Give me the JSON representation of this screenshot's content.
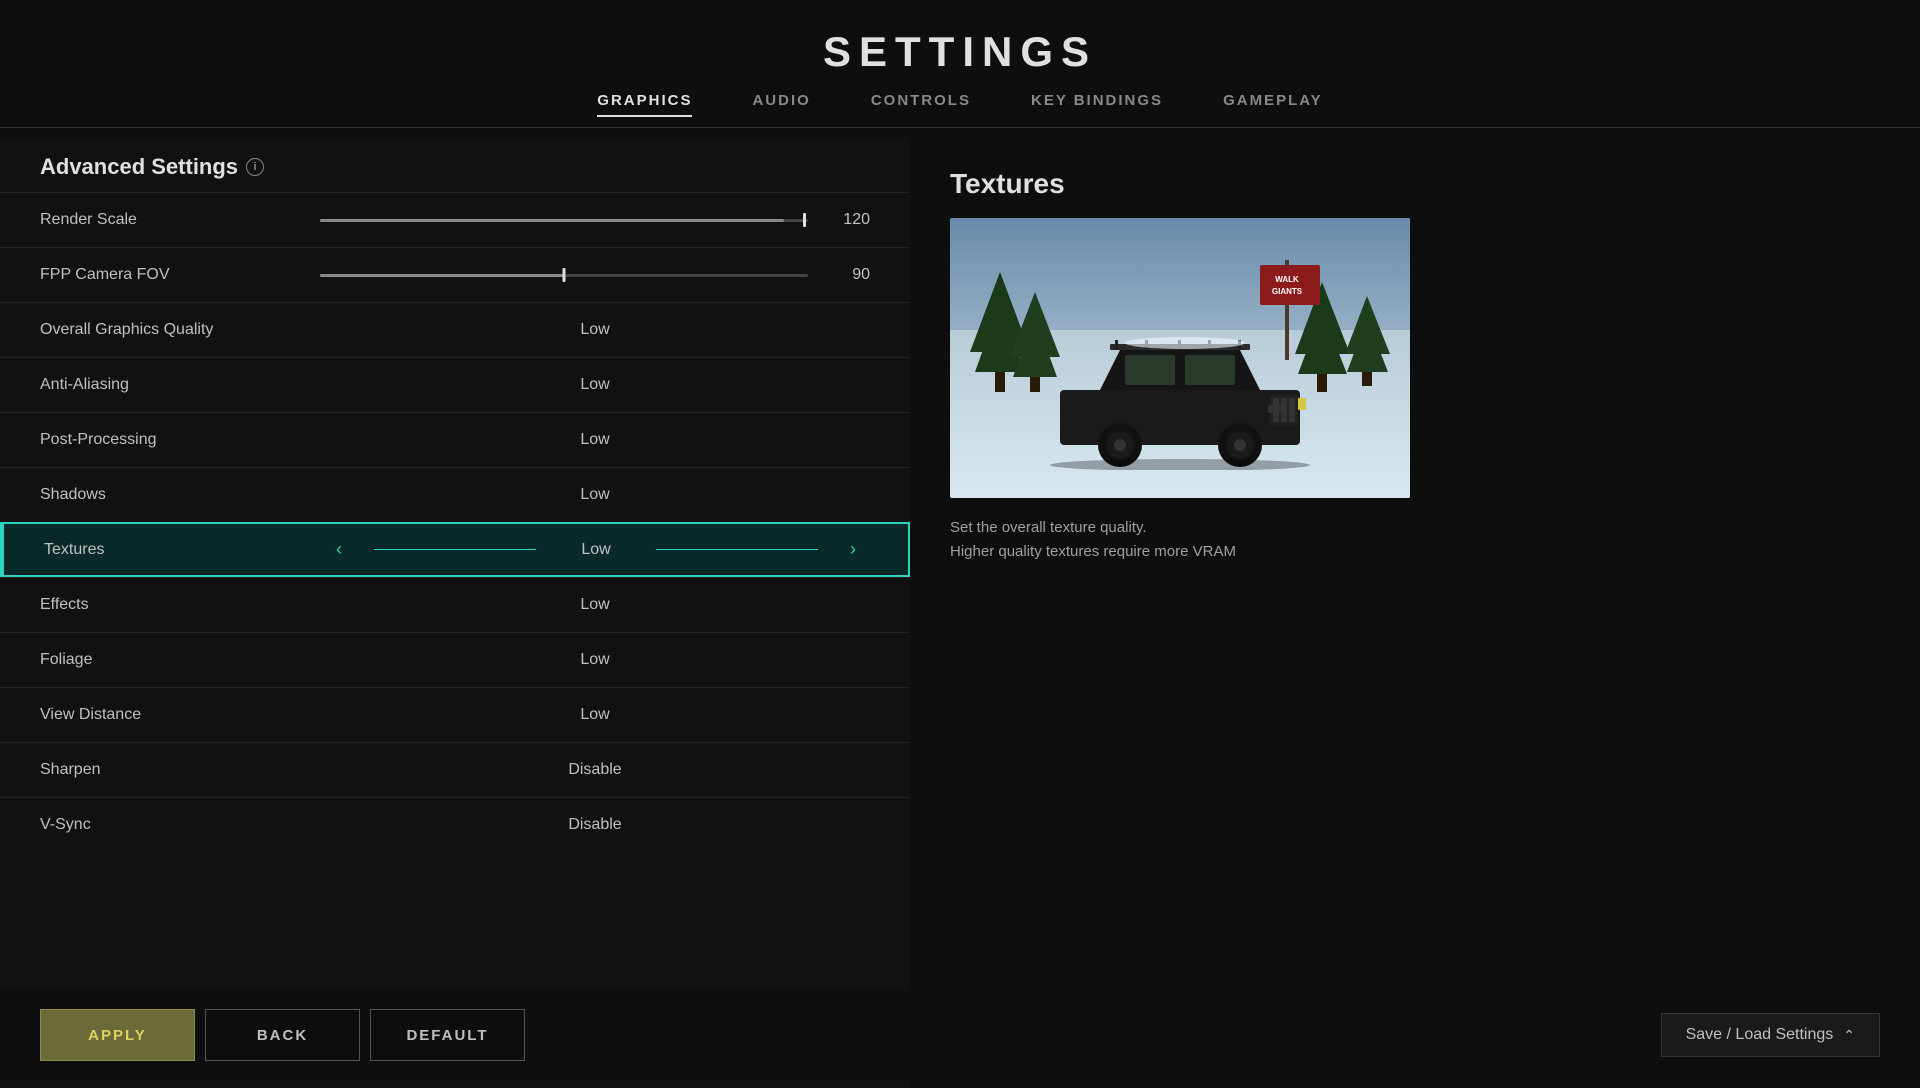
{
  "header": {
    "title": "SETTINGS",
    "tabs": [
      {
        "label": "GRAPHICS",
        "active": true
      },
      {
        "label": "AUDIO",
        "active": false
      },
      {
        "label": "CONTROLS",
        "active": false
      },
      {
        "label": "KEY BINDINGS",
        "active": false
      },
      {
        "label": "GAMEPLAY",
        "active": false
      }
    ]
  },
  "section": {
    "title": "Advanced Settings"
  },
  "settings_rows": [
    {
      "id": "render-scale",
      "label": "Render Scale",
      "type": "slider",
      "value": "120",
      "fill_percent": 95
    },
    {
      "id": "fpp-camera-fov",
      "label": "FPP Camera FOV",
      "type": "slider",
      "value": "90",
      "fill_percent": 50
    },
    {
      "id": "overall-graphics-quality",
      "label": "Overall Graphics Quality",
      "type": "dropdown",
      "value": "Low"
    },
    {
      "id": "anti-aliasing",
      "label": "Anti-Aliasing",
      "type": "dropdown",
      "value": "Low"
    },
    {
      "id": "post-processing",
      "label": "Post-Processing",
      "type": "dropdown",
      "value": "Low"
    },
    {
      "id": "shadows",
      "label": "Shadows",
      "type": "dropdown",
      "value": "Low"
    },
    {
      "id": "textures",
      "label": "Textures",
      "type": "dropdown",
      "value": "Low",
      "selected": true
    },
    {
      "id": "effects",
      "label": "Effects",
      "type": "dropdown",
      "value": "Low"
    },
    {
      "id": "foliage",
      "label": "Foliage",
      "type": "dropdown",
      "value": "Low"
    },
    {
      "id": "view-distance",
      "label": "View Distance",
      "type": "dropdown",
      "value": "Low"
    },
    {
      "id": "sharpen",
      "label": "Sharpen",
      "type": "dropdown",
      "value": "Disable"
    },
    {
      "id": "v-sync",
      "label": "V-Sync",
      "type": "dropdown",
      "value": "Disable"
    }
  ],
  "preview": {
    "title": "Textures",
    "description_line1": "Set the overall texture quality.",
    "description_line2": "Higher quality textures require more VRAM"
  },
  "buttons": {
    "apply": "APPLY",
    "back": "BACK",
    "default": "DEFAULT",
    "save_load": "Save / Load Settings"
  }
}
